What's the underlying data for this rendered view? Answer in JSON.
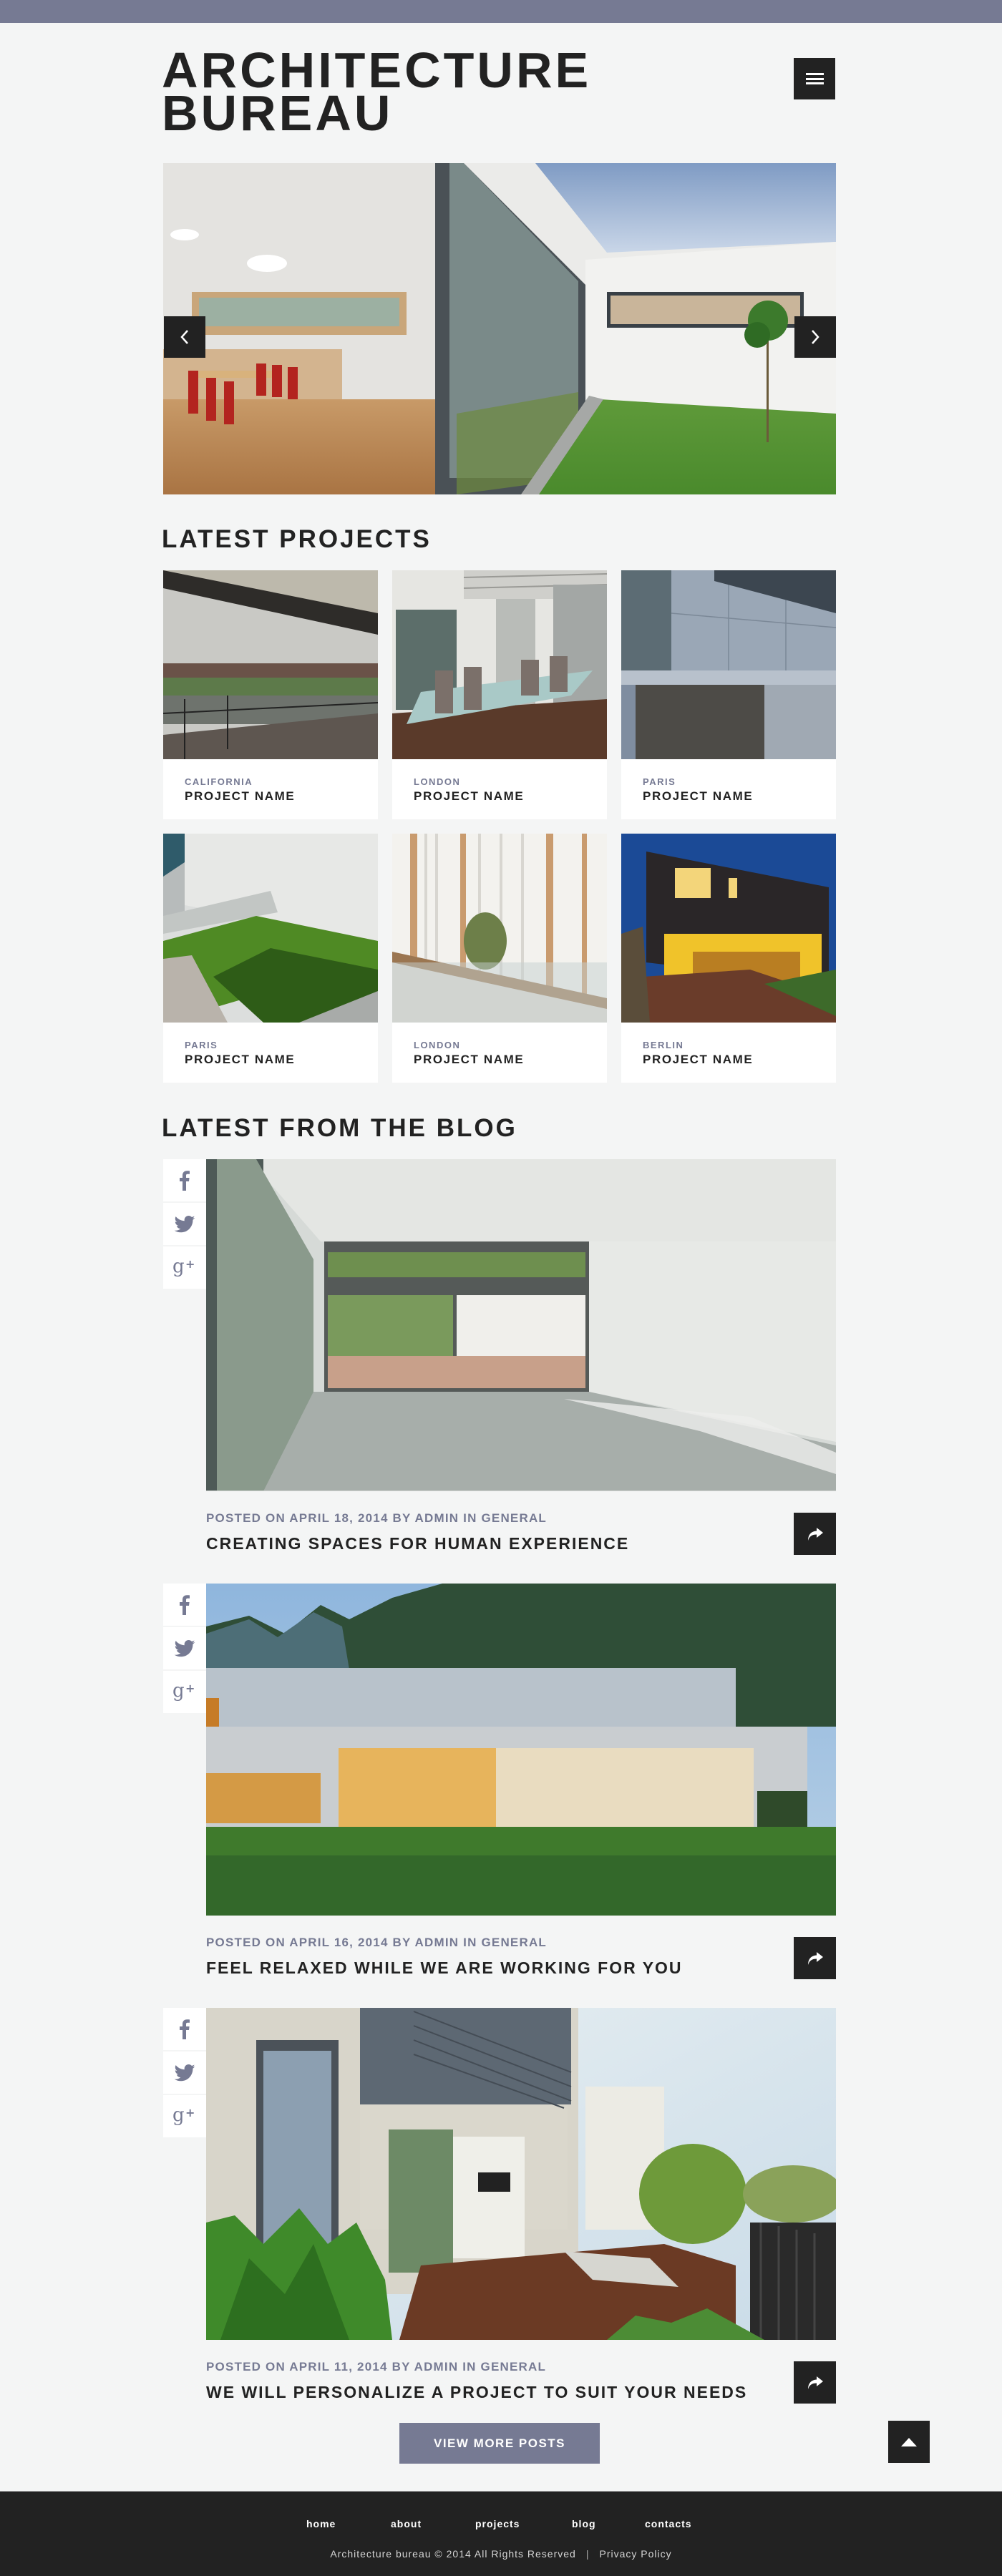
{
  "header": {
    "title_line1": "ARCHITECTURE",
    "title_line2": "BUREAU",
    "menu_icon": "hamburger-menu-icon"
  },
  "slider": {
    "image": "interior dining room opening to courtyard lawn",
    "prev_icon": "chevron-left-icon",
    "next_icon": "chevron-right-icon"
  },
  "projects": {
    "heading": "LATEST PROJECTS",
    "items": [
      {
        "location": "CALIFORNIA",
        "name": "PROJECT NAME",
        "image": "glass pavilion by the water"
      },
      {
        "location": "LONDON",
        "name": "PROJECT NAME",
        "image": "terrace with glass dining table"
      },
      {
        "location": "PARIS",
        "name": "PROJECT NAME",
        "image": "concrete facade with stone wall"
      },
      {
        "location": "PARIS",
        "name": "PROJECT NAME",
        "image": "courtyard with lawn and white wall"
      },
      {
        "location": "LONDON",
        "name": "PROJECT NAME",
        "image": "atrium with tall windows and plant"
      },
      {
        "location": "BERLIN",
        "name": "PROJECT NAME",
        "image": "dark house lit at dusk"
      }
    ]
  },
  "blog": {
    "heading": "LATEST FROM THE BLOG",
    "social_icons": [
      "facebook-icon",
      "twitter-icon",
      "google-plus-icon"
    ],
    "share_icon": "share-arrow-icon",
    "posts": [
      {
        "meta": "POSTED ON APRIL 18, 2014 BY ADMIN IN GENERAL",
        "title": "CREATING SPACES FOR HUMAN EXPERIENCE",
        "image": "empty minimalist room with glass doors"
      },
      {
        "meta": "POSTED ON APRIL 16, 2014 BY ADMIN IN GENERAL",
        "title": "FEEL RELAXED WHILE WE ARE WORKING FOR YOU",
        "image": "white modern house with lawn and mountains"
      },
      {
        "meta": "POSTED ON APRIL 11, 2014 BY ADMIN IN GENERAL",
        "title": "WE WILL PERSONALIZE A PROJECT TO SUIT YOUR NEEDS",
        "image": "house with wooden deck and garden"
      }
    ],
    "view_more": "VIEW MORE POSTS"
  },
  "scroll_top_icon": "arrow-up-icon",
  "footer": {
    "nav": [
      "home",
      "about",
      "projects",
      "blog",
      "contacts"
    ],
    "copyright": "Architecture bureau © 2014 All Rights Reserved",
    "separator": "|",
    "privacy": "Privacy Policy"
  },
  "colors": {
    "accent": "#767a93",
    "dark": "#222222",
    "background": "#f4f5f5"
  }
}
